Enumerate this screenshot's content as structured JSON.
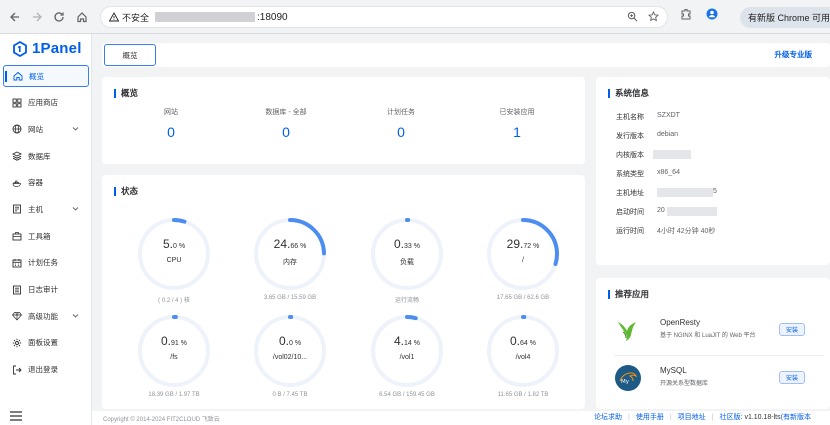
{
  "browser": {
    "security_label": "不安全",
    "url_suffix": ":18090",
    "update_button": "有新版 Chrome 可用"
  },
  "brand": {
    "name": "1Panel",
    "color": "#005eeb"
  },
  "sidebar": {
    "items": [
      {
        "label": "概览",
        "icon": "home-icon"
      },
      {
        "label": "应用商店",
        "icon": "grid-icon"
      },
      {
        "label": "网站",
        "icon": "globe-icon"
      },
      {
        "label": "数据库",
        "icon": "database-icon"
      },
      {
        "label": "容器",
        "icon": "container-icon"
      },
      {
        "label": "主机",
        "icon": "server-icon"
      },
      {
        "label": "工具箱",
        "icon": "toolbox-icon"
      },
      {
        "label": "计划任务",
        "icon": "calendar-icon"
      },
      {
        "label": "日志审计",
        "icon": "log-icon"
      },
      {
        "label": "高级功能",
        "icon": "diamond-icon"
      },
      {
        "label": "面板设置",
        "icon": "settings-icon"
      },
      {
        "label": "退出登录",
        "icon": "logout-icon"
      }
    ]
  },
  "tabs": {
    "active": "概览",
    "upgrade": "升级专业版"
  },
  "overview": {
    "title": "概览",
    "items": [
      {
        "label": "网站",
        "value": "0"
      },
      {
        "label": "数据库 - 全部",
        "value": "0"
      },
      {
        "label": "计划任务",
        "value": "0"
      },
      {
        "label": "已安装应用",
        "value": "1"
      }
    ]
  },
  "status": {
    "title": "状态",
    "gauges": [
      {
        "int": "5.",
        "dec": "0",
        "unit": " %",
        "percent": 5.0,
        "name": "CPU",
        "sub": "( 0.2 / 4 ) 核"
      },
      {
        "int": "24.",
        "dec": "66",
        "unit": " %",
        "percent": 24.66,
        "name": "内存",
        "sub": "3.65 GB / 15.59 GB"
      },
      {
        "int": "0.",
        "dec": "33",
        "unit": " %",
        "percent": 0.33,
        "name": "负载",
        "sub": "运行流畅"
      },
      {
        "int": "29.",
        "dec": "72",
        "unit": " %",
        "percent": 29.72,
        "name": "/",
        "sub": "17.65 GB / 62.6 GB"
      },
      {
        "int": "0.",
        "dec": "91",
        "unit": " %",
        "percent": 0.91,
        "name": "/fs",
        "sub": "18.39 GB / 1.97 TB"
      },
      {
        "int": "0.",
        "dec": "0",
        "unit": " %",
        "percent": 0.0,
        "name": "/vol02/10...",
        "sub": "0 B / 7.45 TB"
      },
      {
        "int": "4.",
        "dec": "14",
        "unit": " %",
        "percent": 4.14,
        "name": "/vol1",
        "sub": "6.54 GB / 159.45 GB"
      },
      {
        "int": "0.",
        "dec": "64",
        "unit": " %",
        "percent": 0.64,
        "name": "/vol4",
        "sub": "11.65 GB / 1.82 TB"
      }
    ]
  },
  "system": {
    "title": "系统信息",
    "rows": [
      {
        "key": "主机名称",
        "value": "SZXDT"
      },
      {
        "key": "发行版本",
        "value": "debian"
      },
      {
        "key": "内核版本",
        "value": ""
      },
      {
        "key": "系统类型",
        "value": "x86_64"
      },
      {
        "key": "主机地址",
        "value": "",
        "tail": "5"
      },
      {
        "key": "启动时间",
        "value": "20"
      },
      {
        "key": "运行时间",
        "value": "4小时 42分钟 40秒"
      }
    ]
  },
  "recommended": {
    "title": "推荐应用",
    "apps": [
      {
        "name": "OpenResty",
        "desc": "基于 NGINX 和 LuaJIT 的 Web 平台",
        "action": "安装"
      },
      {
        "name": "MySQL",
        "desc": "开源关系型数据库",
        "action": "安装"
      }
    ]
  },
  "footer": {
    "copyright": "Copyright © 2014-2024 FIT2CLOUD 飞致云",
    "links": [
      "论坛求助",
      "使用手册",
      "项目地址"
    ],
    "edition_label": "社区版:",
    "version": "v1.10.18-lts",
    "new_version": "(有新版本"
  },
  "colors": {
    "primary": "#005eeb",
    "gauge_track": "#eef3fb",
    "gauge_fill": "#4d8df0"
  }
}
